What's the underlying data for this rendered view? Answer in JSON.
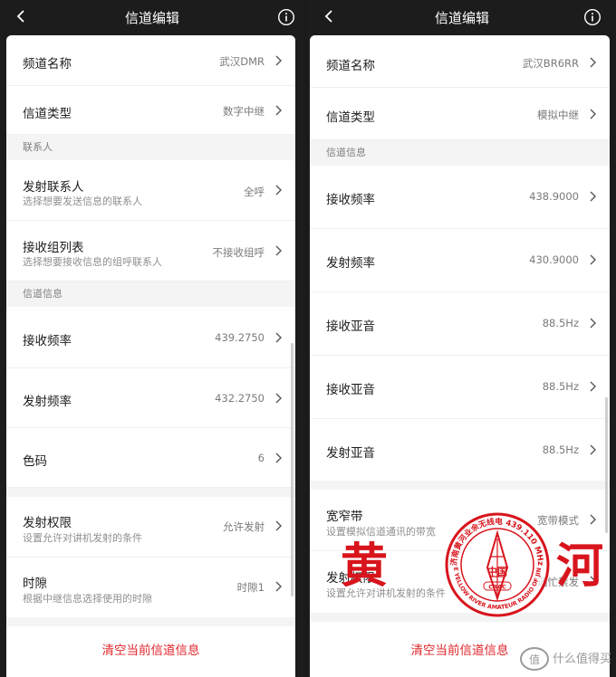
{
  "left": {
    "nav": {
      "title": "信道编辑"
    },
    "rows": {
      "channel_name": {
        "title": "频道名称",
        "value": "武汉DMR"
      },
      "channel_type": {
        "title": "信道类型",
        "value": "数字中继"
      },
      "tx_contact": {
        "title": "发射联系人",
        "sub": "选择想要发送信息的联系人",
        "value": "全呼"
      },
      "rx_group": {
        "title": "接收组列表",
        "sub": "选择想要接收信息的组呼联系人",
        "value": "不接收组呼"
      },
      "rx_freq": {
        "title": "接收频率",
        "value": "439.2750"
      },
      "tx_freq": {
        "title": "发射频率",
        "value": "432.2750"
      },
      "color_code": {
        "title": "色码",
        "value": "6"
      },
      "tx_permission": {
        "title": "发射权限",
        "sub": "设置允许对讲机发射的条件",
        "value": "允许发射"
      },
      "timeslot": {
        "title": "时隙",
        "sub": "根据中继信息选择使用的时隙",
        "value": "时隙1"
      }
    },
    "sections": {
      "contacts": "联系人",
      "channel_info": "信道信息"
    },
    "clear_label": "清空当前信道信息"
  },
  "right": {
    "nav": {
      "title": "信道编辑"
    },
    "rows": {
      "channel_name": {
        "title": "频道名称",
        "value": "武汉BR6RR"
      },
      "channel_type": {
        "title": "信道类型",
        "value": "模拟中继"
      },
      "rx_freq": {
        "title": "接收频率",
        "value": "438.9000"
      },
      "tx_freq": {
        "title": "发射频率",
        "value": "430.9000"
      },
      "rx_tone1": {
        "title": "接收亚音",
        "value": "88.5Hz"
      },
      "rx_tone2": {
        "title": "接收亚音",
        "value": "88.5Hz"
      },
      "tx_tone": {
        "title": "发射亚音",
        "value": "88.5Hz"
      },
      "bandwidth": {
        "title": "宽窄带",
        "sub": "设置模拟信道通讯的带宽",
        "value": "宽带模式"
      },
      "tx_permission": {
        "title": "发射权限",
        "sub": "设置允许对讲机发射的条件",
        "value": "遇忙禁发"
      }
    },
    "sections": {
      "channel_info": "信道信息"
    },
    "clear_label": "清空当前信道信息"
  },
  "stamp": {
    "char_left": "黄",
    "char_right": "河",
    "ring_text": "济南黄河业余无线电 439.110 MHz",
    "ring_text_en": "THE YELLOW RIVER AMATEUR RADIO OF JINAN",
    "center_text": "中国",
    "badge_text": "CRAC"
  },
  "watermark": {
    "text": "什么值得买",
    "logo_text": "值"
  },
  "colors": {
    "accent_red": "#e0252b",
    "stamp_red": "#d8141c",
    "nav_bg": "#1c1c1c",
    "section_bg": "#f4f4f4"
  }
}
